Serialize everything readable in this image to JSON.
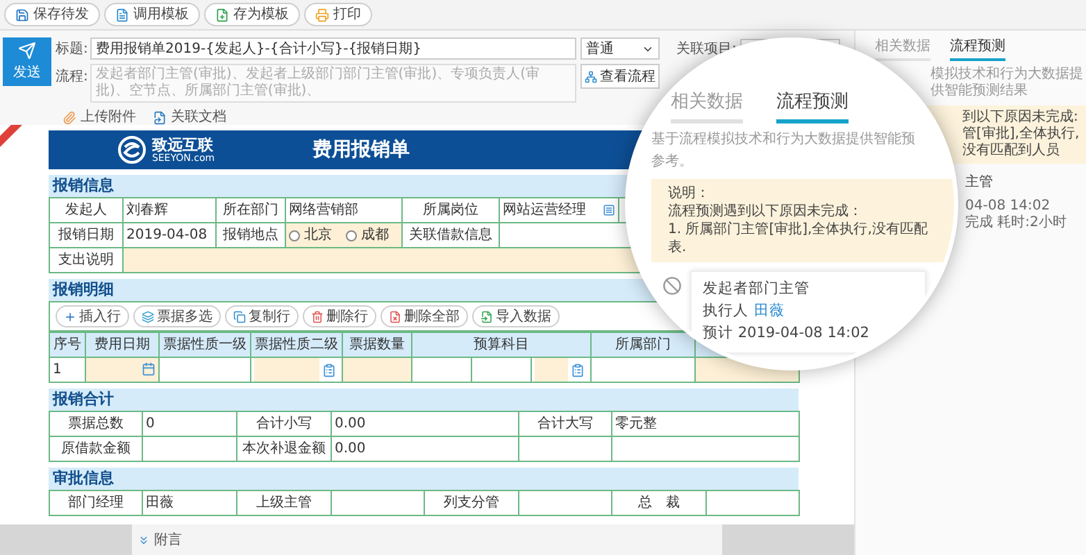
{
  "toolbar": [
    {
      "label": "保存待发"
    },
    {
      "label": "调用模板"
    },
    {
      "label": "存为模板"
    },
    {
      "label": "打印"
    }
  ],
  "send_button": {
    "label": "发送"
  },
  "subject": {
    "label": "标题:",
    "value": "费用报销单2019-{发起人}-{合计小写}-{报销日期}",
    "priority": "普通"
  },
  "process": {
    "label": "流程:",
    "value": "发起者部门主管(审批)、发起者上级部门部门主管(审批)、专项负责人(审批)、空节点、所属部门主管(审批)、",
    "button": "查看流程"
  },
  "related_project": {
    "label": "关联项目:"
  },
  "attachments": [
    {
      "label": "上传附件"
    },
    {
      "label": "关联文档"
    }
  ],
  "form": {
    "brand": "致远互联",
    "brand_sub": "SEEYON.com",
    "title": "费用报销单",
    "info": {
      "title": "报销信息",
      "rows": [
        {
          "cells": [
            {
              "kind": "label",
              "text": "发起人"
            },
            {
              "kind": "text",
              "text": "刘春辉"
            },
            {
              "kind": "label",
              "text": "所在部门"
            },
            {
              "kind": "text",
              "text": "网络营销部"
            },
            {
              "kind": "label",
              "text": "所属岗位"
            },
            {
              "kind": "select",
              "text": "网站运营经理"
            },
            {
              "kind": "text"
            }
          ]
        },
        {
          "cells": [
            {
              "kind": "label",
              "text": "报销日期"
            },
            {
              "kind": "text",
              "text": "2019-04-08"
            },
            {
              "kind": "label",
              "text": "报销地点"
            },
            {
              "kind": "radio",
              "options": [
                {
                  "label": "北京",
                  "selected": false
                },
                {
                  "label": "成都",
                  "selected": false
                }
              ]
            },
            {
              "kind": "label",
              "text": "关联借款信息"
            },
            {
              "kind": "text"
            }
          ]
        },
        {
          "cells": [
            {
              "kind": "label",
              "text": "支出说明"
            },
            {
              "kind": "input"
            }
          ]
        }
      ]
    },
    "detail": {
      "title": "报销明细",
      "buttons": [
        {
          "label": "插入行"
        },
        {
          "label": "票据多选"
        },
        {
          "label": "复制行"
        },
        {
          "label": "删除行"
        },
        {
          "label": "删除全部"
        },
        {
          "label": "导入数据"
        }
      ],
      "columns": [
        {
          "label": "序号"
        },
        {
          "label": "费用日期"
        },
        {
          "label": "票据性质一级"
        },
        {
          "label": "票据性质二级"
        },
        {
          "label": "票据数量"
        },
        {
          "label": "预算科目"
        },
        {
          "label": "所属部门"
        }
      ],
      "rows": [
        {
          "cells": [
            {
              "kind": "text",
              "text": "1"
            },
            {
              "kind": "date"
            },
            {
              "kind": "text"
            },
            {
              "kind": "lookup"
            },
            {
              "kind": "input"
            },
            {
              "kind": "group",
              "parts": [
                {
                  "kind": "text"
                },
                {
                  "kind": "text"
                },
                {
                  "kind": "lookup"
                }
              ]
            },
            {
              "kind": "text"
            },
            {
              "kind": "input"
            }
          ]
        }
      ]
    },
    "totals": {
      "title": "报销合计",
      "rows": [
        {
          "cells": [
            {
              "kind": "label",
              "text": "票据总数"
            },
            {
              "kind": "text",
              "text": "0"
            },
            {
              "kind": "label",
              "text": "合计小写"
            },
            {
              "kind": "text",
              "text": "0.00"
            },
            {
              "kind": "label",
              "text": "合计大写"
            },
            {
              "kind": "text",
              "text": "零元整"
            }
          ]
        },
        {
          "cells": [
            {
              "kind": "label",
              "text": "原借款金额"
            },
            {
              "kind": "text"
            },
            {
              "kind": "label",
              "text": "本次补退金额"
            },
            {
              "kind": "text",
              "text": "0.00"
            },
            {
              "kind": "text"
            },
            {
              "kind": "text"
            }
          ]
        }
      ]
    },
    "approval": {
      "title": "审批信息",
      "rows": [
        {
          "cells": [
            {
              "kind": "label",
              "text": "部门经理"
            },
            {
              "kind": "text",
              "text": "田薇"
            },
            {
              "kind": "label",
              "text": "上级主管"
            },
            {
              "kind": "text"
            },
            {
              "kind": "label",
              "text": "列支分管"
            },
            {
              "kind": "text"
            },
            {
              "kind": "label",
              "text": "总　裁"
            },
            {
              "kind": "text"
            }
          ]
        }
      ]
    }
  },
  "footer": {
    "label": "附言"
  },
  "side_panel": {
    "tabs": [
      {
        "label": "相关数据",
        "selected": false
      },
      {
        "label": "流程预测",
        "selected": true
      }
    ],
    "intro": "模拟技术和行为大数据提供智能预测结果",
    "notice": [
      "到以下原因未完成:",
      "管[审批],全体执行,没有匹配到人员"
    ],
    "node_title": "主管",
    "node_time": [
      "04-08 14:02",
      "完成 耗时:2小时"
    ]
  },
  "magnifier": {
    "tabs": [
      {
        "label": "相关数据",
        "selected": false
      },
      {
        "label": "流程预测",
        "selected": true
      }
    ],
    "intro": [
      "基于流程模拟技术和行为大数据提供智能预",
      "参考。"
    ],
    "notice": [
      "说明：",
      "流程预测遇到以下原因未完成：",
      "1. 所属部门主管[审批],全体执行,没有匹配",
      "表."
    ],
    "node": {
      "title": "发起者部门主管",
      "executor_label": "执行人",
      "executor": "田薇",
      "estimate": "预计 2019-04-08 14:02"
    }
  }
}
